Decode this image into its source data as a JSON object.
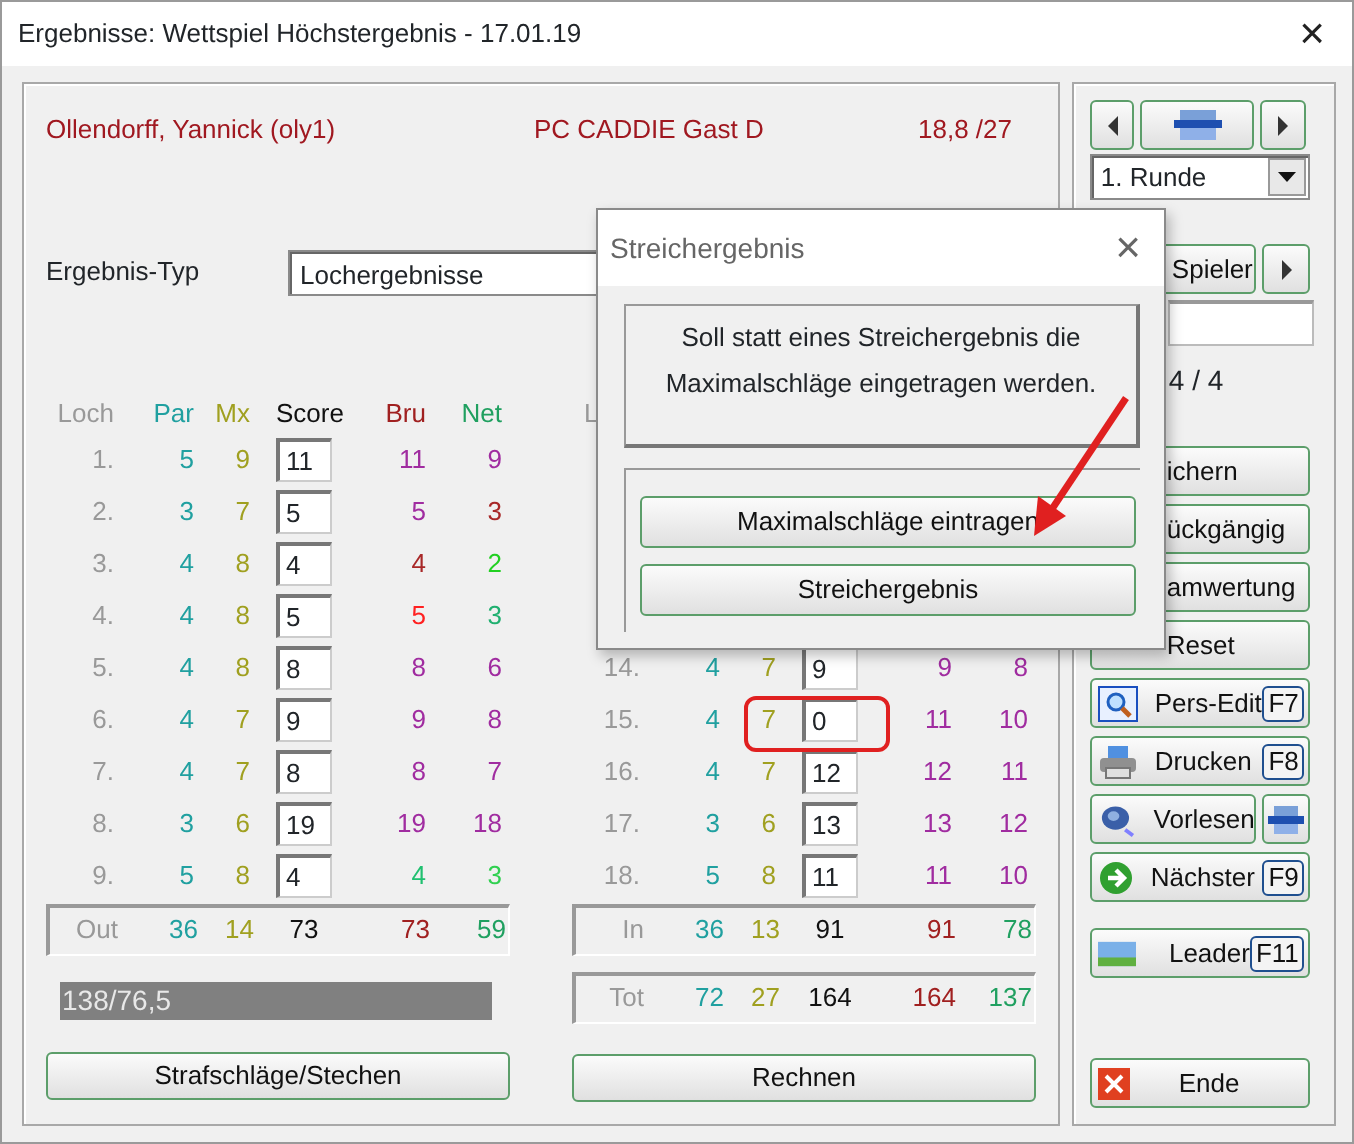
{
  "window": {
    "title": "Ergebnisse: Wettspiel Höchstergebnis - 17.01.19",
    "close": "×"
  },
  "player": {
    "name": "Ollendorff, Yannick (oly1)",
    "category": "PC CADDIE Gast D",
    "handicap": "18,8 /27"
  },
  "result_type": {
    "label": "Ergebnis-Typ",
    "value": "Lochergebnisse"
  },
  "front_nine": {
    "columns": [
      "Loch",
      "Par",
      "Mx",
      "Score",
      "Bru",
      "Net"
    ],
    "rows": [
      {
        "hole": "1.",
        "par": "5",
        "mx": "9",
        "score": "11",
        "bru": {
          "value": "11",
          "color": "#a02ca0"
        },
        "net": {
          "value": "9",
          "color": "#a02ca0"
        }
      },
      {
        "hole": "2.",
        "par": "3",
        "mx": "7",
        "score": "5",
        "bru": {
          "value": "5",
          "color": "#a02ca0"
        },
        "net": {
          "value": "3",
          "color": "#a82828"
        }
      },
      {
        "hole": "3.",
        "par": "4",
        "mx": "8",
        "score": "4",
        "bru": {
          "value": "4",
          "color": "#a82828"
        },
        "net": {
          "value": "2",
          "color": "#22d022"
        }
      },
      {
        "hole": "4.",
        "par": "4",
        "mx": "8",
        "score": "5",
        "bru": {
          "value": "5",
          "color": "#ff2020"
        },
        "net": {
          "value": "3",
          "color": "#20b070"
        }
      },
      {
        "hole": "5.",
        "par": "4",
        "mx": "8",
        "score": "8",
        "bru": {
          "value": "8",
          "color": "#a02ca0"
        },
        "net": {
          "value": "6",
          "color": "#a02ca0"
        }
      },
      {
        "hole": "6.",
        "par": "4",
        "mx": "7",
        "score": "9",
        "bru": {
          "value": "9",
          "color": "#a02ca0"
        },
        "net": {
          "value": "8",
          "color": "#a02ca0"
        }
      },
      {
        "hole": "7.",
        "par": "4",
        "mx": "7",
        "score": "8",
        "bru": {
          "value": "8",
          "color": "#a02ca0"
        },
        "net": {
          "value": "7",
          "color": "#a02ca0"
        }
      },
      {
        "hole": "8.",
        "par": "3",
        "mx": "6",
        "score": "19",
        "bru": {
          "value": "19",
          "color": "#a02ca0"
        },
        "net": {
          "value": "18",
          "color": "#a02ca0"
        }
      },
      {
        "hole": "9.",
        "par": "5",
        "mx": "8",
        "score": "4",
        "bru": {
          "value": "4",
          "color": "#20c070"
        },
        "net": {
          "value": "3",
          "color": "#30d050"
        }
      }
    ],
    "totals": [
      {
        "label": "Out",
        "par": "36",
        "mx": "14",
        "score": "73",
        "bru": "73",
        "net": "59"
      }
    ]
  },
  "back_nine": {
    "columns": [
      "L"
    ],
    "rows": [
      {
        "hole": "14.",
        "par": "4",
        "mx": "7",
        "score": "9",
        "bru": {
          "value": "9",
          "color": "#a02ca0"
        },
        "net": {
          "value": "8",
          "color": "#a02ca0"
        }
      },
      {
        "hole": "15.",
        "par": "4",
        "mx": "7",
        "score": "0",
        "bru": {
          "value": "11",
          "color": "#a02ca0"
        },
        "net": {
          "value": "10",
          "color": "#a02ca0"
        }
      },
      {
        "hole": "16.",
        "par": "4",
        "mx": "7",
        "score": "12",
        "bru": {
          "value": "12",
          "color": "#a02ca0"
        },
        "net": {
          "value": "11",
          "color": "#a02ca0"
        }
      },
      {
        "hole": "17.",
        "par": "3",
        "mx": "6",
        "score": "13",
        "bru": {
          "value": "13",
          "color": "#a02ca0"
        },
        "net": {
          "value": "12",
          "color": "#a02ca0"
        }
      },
      {
        "hole": "18.",
        "par": "5",
        "mx": "8",
        "score": "11",
        "bru": {
          "value": "11",
          "color": "#a02ca0"
        },
        "net": {
          "value": "10",
          "color": "#a02ca0"
        }
      }
    ],
    "totals": [
      {
        "label": "In",
        "par": "36",
        "mx": "13",
        "score": "91",
        "bru": "91",
        "net": "78"
      },
      {
        "label": "Tot",
        "par": "72",
        "mx": "27",
        "score": "164",
        "bru": "164",
        "net": "137"
      }
    ]
  },
  "handicap_bar": {
    "text": "138/76,5"
  },
  "bottom_buttons": [
    "Strafschläge/Stechen",
    "Rechnen"
  ],
  "round_select": {
    "value": "1. Runde"
  },
  "player_nav": {
    "button": "Spieler",
    "counter": "4 / 4"
  },
  "actions": [
    {
      "label": "ichern",
      "kind": "plain"
    },
    {
      "label": "ückgängig",
      "kind": "plain"
    },
    {
      "label": "amwertung",
      "kind": "plain"
    },
    {
      "label": "Reset",
      "kind": "plain"
    },
    {
      "label": "Pers-Edit",
      "kind": "edit",
      "fkey": "F7"
    },
    {
      "label": "Drucken",
      "kind": "print",
      "fkey": "F8"
    },
    {
      "label": "Vorlesen",
      "kind": "speaker"
    },
    {
      "label": "Nächster",
      "kind": "next",
      "fkey": "F9"
    },
    {
      "label": "Leader",
      "kind": "leader",
      "fkey": "F11"
    },
    {
      "label": "Ende",
      "kind": "exit"
    }
  ],
  "dialog": {
    "title": "Streichergebnis",
    "close": "×",
    "message": "Soll statt eines Streichergebnis die Maximalschläge eingetragen werden.",
    "buttons": [
      "Maximalschläge eintragen",
      "Streichergebnis"
    ]
  }
}
